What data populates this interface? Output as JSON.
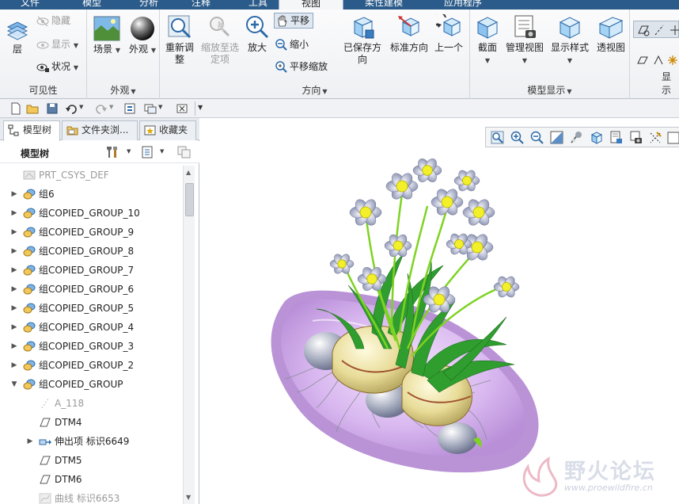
{
  "ribbon": {
    "tabs": [
      "文件",
      "模型",
      "分析",
      "注释",
      "工具",
      "视图",
      "柔性建模",
      "应用程序"
    ],
    "active_tab": "视图",
    "groups": {
      "visibility": {
        "label": "可见性",
        "layer": "层",
        "hide": "隐藏",
        "show": "显示",
        "status": "状况"
      },
      "appearance": {
        "label": "外观",
        "scene": "场景",
        "appearance": "外观"
      },
      "orientation": {
        "label": "方向",
        "refit": "重新调整",
        "zoom_to_selected": "缩放至选定项",
        "zoom_in": "放大",
        "pan": "平移",
        "zoom_out": "缩小",
        "pan_zoom": "平移缩放",
        "saved_orientations": "已保存方向",
        "standard_orientation": "标准方向",
        "previous": "上一个"
      },
      "model_display": {
        "label": "模型显示",
        "section": "截面",
        "manage_views": "管理视图",
        "display_style": "显示样式",
        "perspective": "透视图"
      },
      "show_display": {
        "label": "显示"
      }
    }
  },
  "panel": {
    "tabs": [
      "模型树",
      "文件夹浏...",
      "收藏夹"
    ],
    "tree_title": "模型树",
    "items": [
      {
        "label": "PRT_CSYS_DEF",
        "state": "disabled",
        "expand": "",
        "icon": "csys-icon"
      },
      {
        "label": "组6",
        "state": "normal",
        "expand": "▶",
        "icon": "group-icon"
      },
      {
        "label": "组COPIED_GROUP_10",
        "state": "normal",
        "expand": "▶",
        "icon": "group-icon"
      },
      {
        "label": "组COPIED_GROUP_9",
        "state": "normal",
        "expand": "▶",
        "icon": "group-icon"
      },
      {
        "label": "组COPIED_GROUP_8",
        "state": "normal",
        "expand": "▶",
        "icon": "group-icon"
      },
      {
        "label": "组COPIED_GROUP_7",
        "state": "normal",
        "expand": "▶",
        "icon": "group-icon"
      },
      {
        "label": "组COPIED_GROUP_6",
        "state": "normal",
        "expand": "▶",
        "icon": "group-icon"
      },
      {
        "label": "组COPIED_GROUP_5",
        "state": "normal",
        "expand": "▶",
        "icon": "group-icon"
      },
      {
        "label": "组COPIED_GROUP_4",
        "state": "normal",
        "expand": "▶",
        "icon": "group-icon"
      },
      {
        "label": "组COPIED_GROUP_3",
        "state": "normal",
        "expand": "▶",
        "icon": "group-icon"
      },
      {
        "label": "组COPIED_GROUP_2",
        "state": "normal",
        "expand": "▶",
        "icon": "group-icon"
      },
      {
        "label": "组COPIED_GROUP",
        "state": "normal",
        "expand": "▼",
        "icon": "group-icon"
      },
      {
        "label": "A_118",
        "state": "disabled",
        "expand": "",
        "icon": "axis-icon",
        "child": true
      },
      {
        "label": "DTM4",
        "state": "normal",
        "expand": "",
        "icon": "datum-plane-icon",
        "child": true
      },
      {
        "label": "伸出项 标识6649",
        "state": "normal",
        "expand": "▶",
        "icon": "protrusion-icon",
        "child": true
      },
      {
        "label": "DTM5",
        "state": "normal",
        "expand": "",
        "icon": "datum-plane-icon",
        "child": true
      },
      {
        "label": "DTM6",
        "state": "normal",
        "expand": "",
        "icon": "datum-plane-icon",
        "child": true
      },
      {
        "label": "曲线 标识6653",
        "state": "disabled",
        "expand": "",
        "icon": "curve-icon",
        "child": true
      }
    ]
  },
  "watermark": {
    "title": "野火论坛",
    "url": "www.proewildfire.cn"
  },
  "colors": {
    "tab_bar": "#2b5b8a",
    "ribbon_bg": "#eef0f3",
    "plate": "#d9b8f0",
    "bulb": "#e8dc98",
    "leaf": "#2f9e2f",
    "petal": "#aab0c8",
    "flower_center": "#f2f02a"
  }
}
